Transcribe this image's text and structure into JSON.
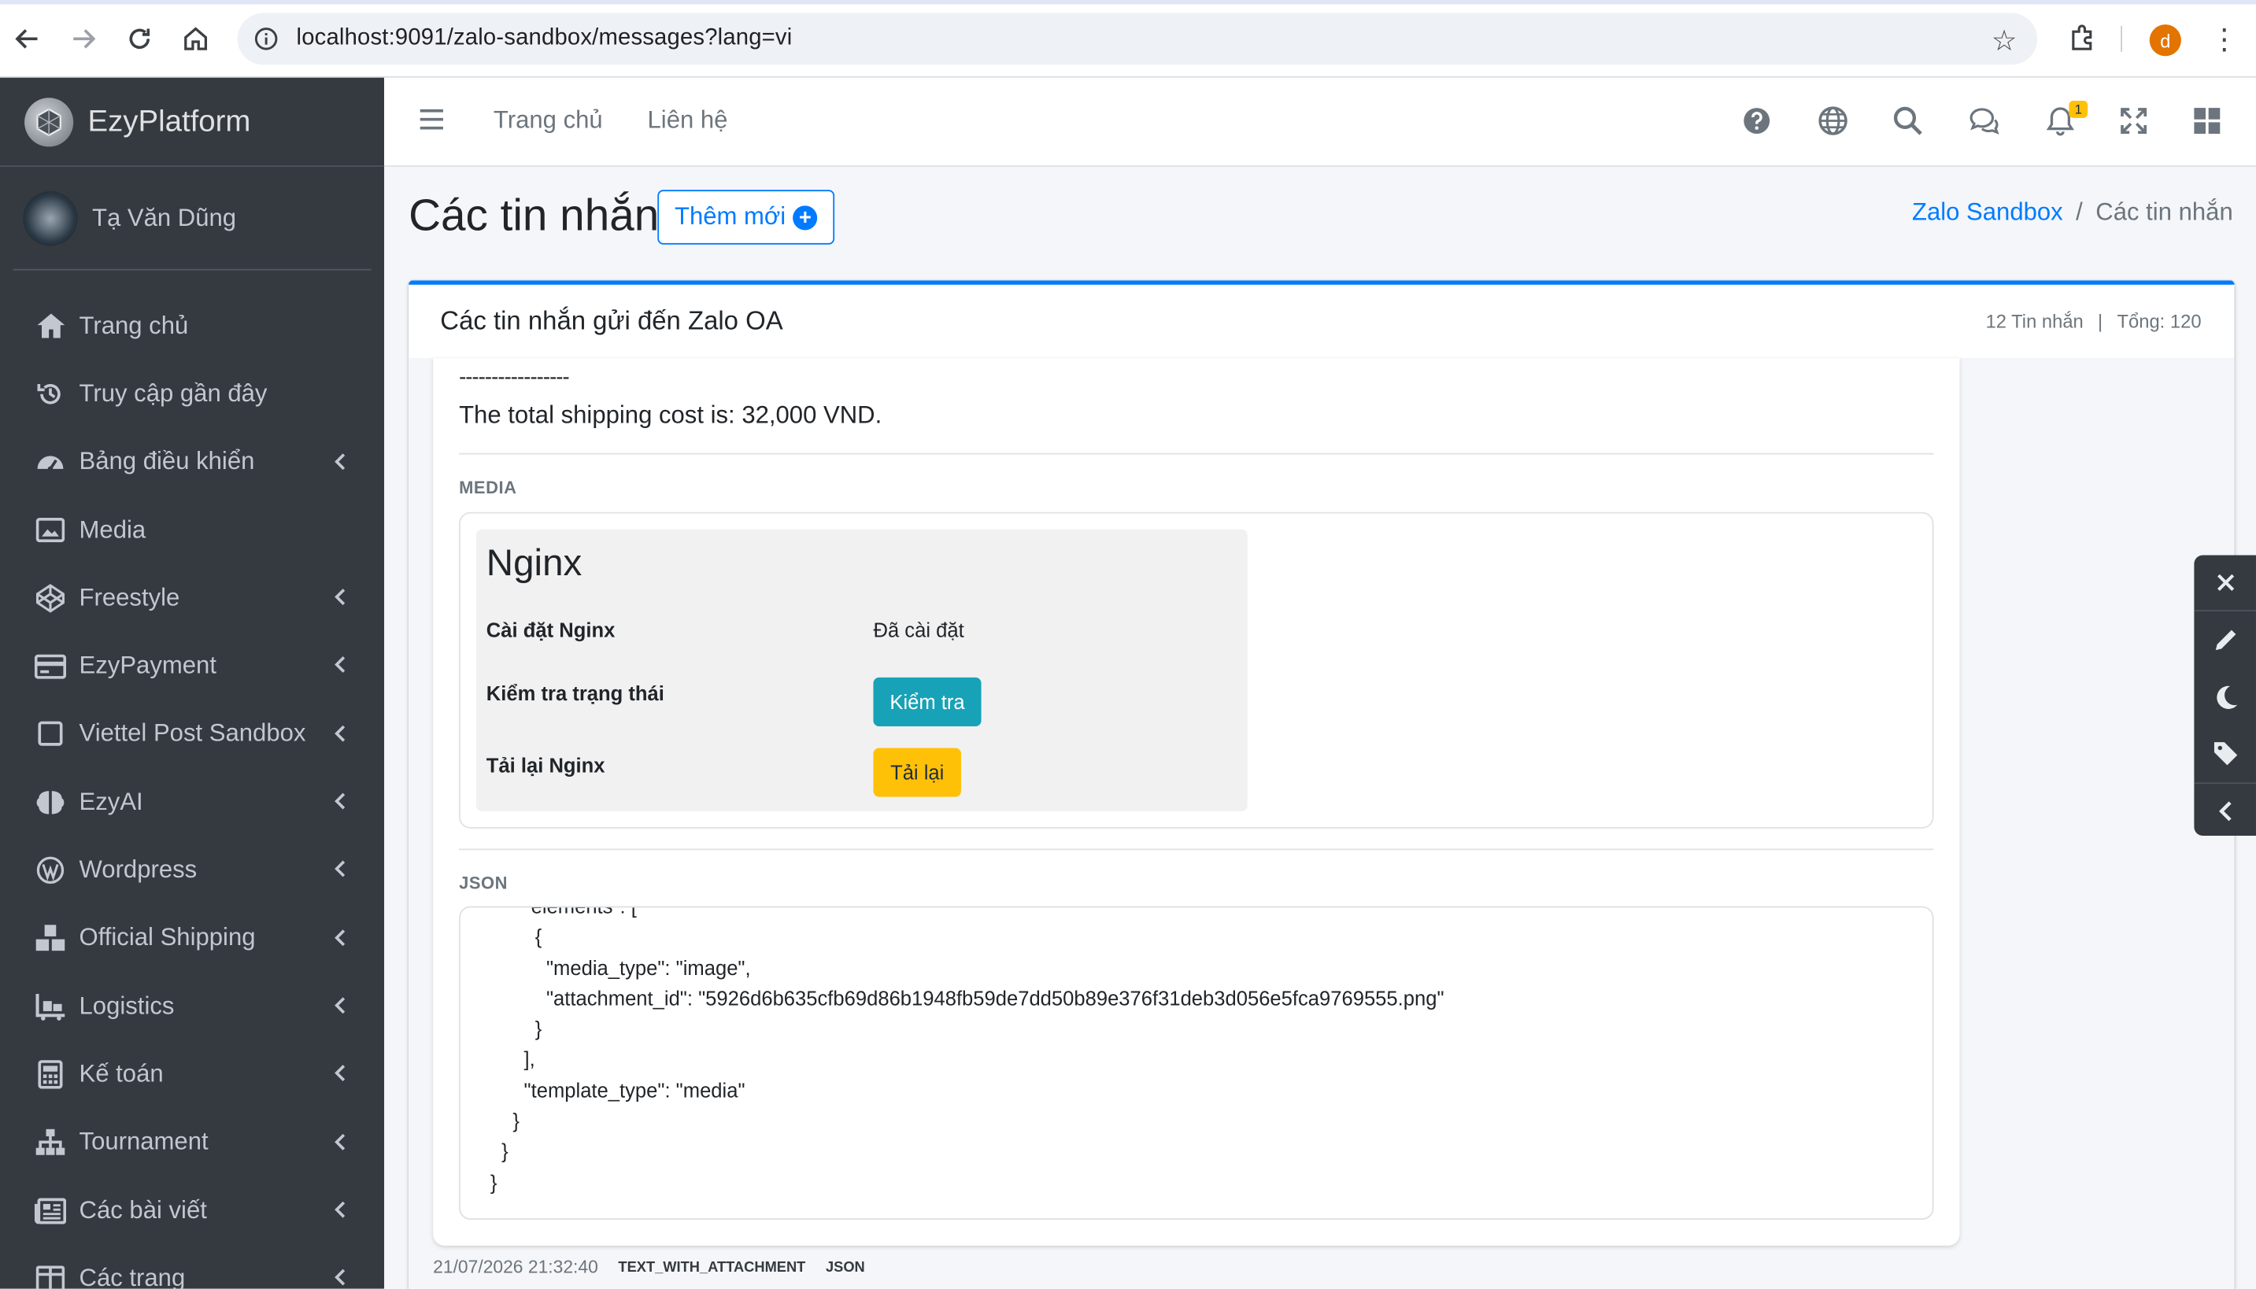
{
  "browser": {
    "url": "localhost:9091/zalo-sandbox/messages?lang=vi",
    "profile_initial": "d"
  },
  "sidebar": {
    "brand": "EzyPlatform",
    "user_name": "Tạ Văn Dũng",
    "items": [
      {
        "label": "Trang chủ",
        "icon": "home-icon",
        "submenu": false
      },
      {
        "label": "Truy cập gần đây",
        "icon": "history-icon",
        "submenu": false
      },
      {
        "label": "Bảng điều khiển",
        "icon": "dashboard-icon",
        "submenu": true
      },
      {
        "label": "Media",
        "icon": "image-icon",
        "submenu": false
      },
      {
        "label": "Freestyle",
        "icon": "codepen-icon",
        "submenu": true
      },
      {
        "label": "EzyPayment",
        "icon": "credit-card-icon",
        "submenu": true
      },
      {
        "label": "Viettel Post Sandbox",
        "icon": "square-icon",
        "submenu": true
      },
      {
        "label": "EzyAI",
        "icon": "brain-icon",
        "submenu": true
      },
      {
        "label": "Wordpress",
        "icon": "wordpress-icon",
        "submenu": true
      },
      {
        "label": "Official Shipping",
        "icon": "boxes-icon",
        "submenu": true
      },
      {
        "label": "Logistics",
        "icon": "pallet-icon",
        "submenu": true
      },
      {
        "label": "Kế toán",
        "icon": "calculator-icon",
        "submenu": true
      },
      {
        "label": "Tournament",
        "icon": "sitemap-icon",
        "submenu": true
      },
      {
        "label": "Các bài viết",
        "icon": "newspaper-icon",
        "submenu": true
      },
      {
        "label": "Các trang",
        "icon": "columns-icon",
        "submenu": true
      }
    ]
  },
  "topnav": {
    "home": "Trang chủ",
    "contact": "Liên hệ",
    "notification_count": "1"
  },
  "header": {
    "title": "Các tin nhắn",
    "add_button": "Thêm mới",
    "breadcrumb_parent": "Zalo Sandbox",
    "breadcrumb_current": "Các tin nhắn"
  },
  "card": {
    "title": "Các tin nhắn gửi đến Zalo OA",
    "message_count": "12 Tin nhắn",
    "total": "Tổng: 120"
  },
  "message": {
    "dashes": "-----------------",
    "shipping_text": "The total shipping cost is: 32,000 VND.",
    "media_label": "MEDIA",
    "json_label": "JSON",
    "json_text": "        \"elements\": [\n          {\n            \"media_type\": \"image\",\n            \"attachment_id\": \"5926d6b635cfb69d86b1948fb59de7dd50b89e376f31deb3d056e5fca9769555.png\"\n          }\n        ],\n        \"template_type\": \"media\"\n      }\n    }\n  }",
    "timestamp": "21/07/2026 21:32:40",
    "type_tag": "TEXT_WITH_ATTACHMENT",
    "format_tag": "JSON"
  },
  "nginx": {
    "title": "Nginx",
    "install_label": "Cài đặt Nginx",
    "install_value": "Đã cài đặt",
    "check_label": "Kiểm tra trạng thái",
    "check_button": "Kiểm tra",
    "reload_label": "Tải lại Nginx",
    "reload_button": "Tải lại"
  },
  "colors": {
    "primary": "#007bff",
    "sidebar_bg": "#343a40",
    "info": "#17a2b8",
    "warning": "#ffc107"
  }
}
